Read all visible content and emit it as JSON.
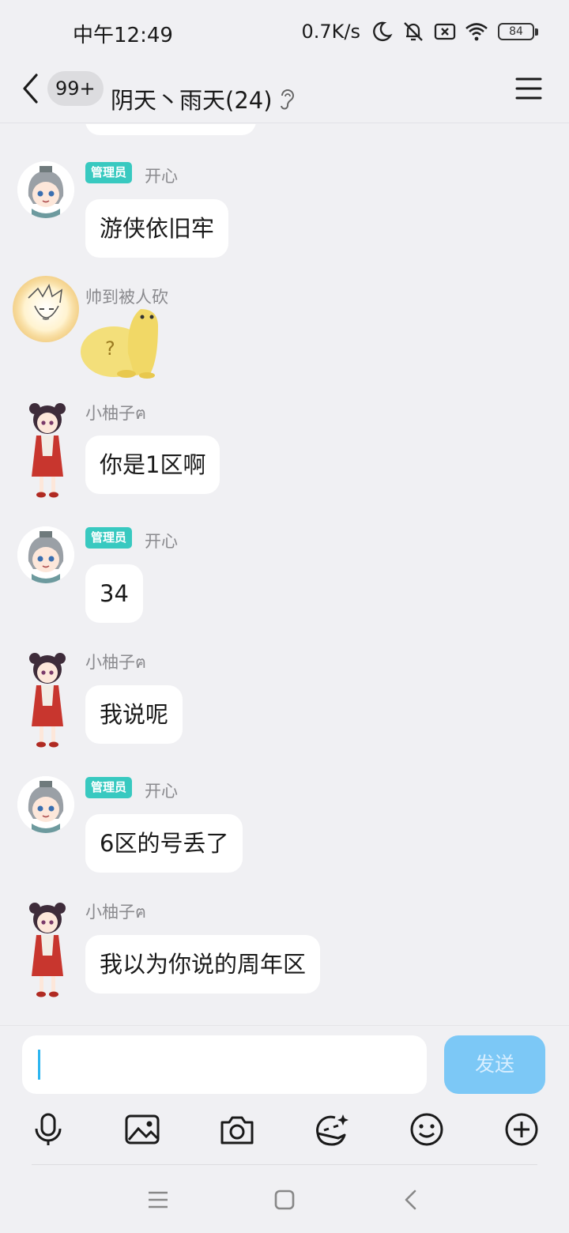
{
  "status_bar": {
    "time": "中午12:49",
    "net_speed": "0.7K/s",
    "battery": "84",
    "icons": [
      "moon-icon",
      "bell-off-icon",
      "sim-x-icon",
      "wifi-icon",
      "battery-icon"
    ]
  },
  "header": {
    "back_icon": "chevron-left-icon",
    "unread_count": "99+",
    "title": "阴天丶雨天(24)",
    "ear_icon": "ear-icon",
    "menu_icon": "hamburger-menu-icon"
  },
  "messages": [
    {
      "sender": "",
      "text": ""
    },
    {
      "sender": "开心",
      "role": "管理员",
      "text": "游侠依旧牢"
    },
    {
      "sender": "帅到被人砍",
      "text": "",
      "sticker": "yellow-blob-question-sticker"
    },
    {
      "sender": "小柚子ฅ",
      "text": "你是1区啊"
    },
    {
      "sender": "开心",
      "role": "管理员",
      "text": "34"
    },
    {
      "sender": "小柚子ฅ",
      "text": "我说呢"
    },
    {
      "sender": "开心",
      "role": "管理员",
      "text": "6区的号丢了"
    },
    {
      "sender": "小柚子ฅ",
      "text": "我以为你说的周年区"
    }
  ],
  "composer": {
    "input_value": "",
    "send_label": "发送",
    "tools": [
      "microphone-icon",
      "image-icon",
      "camera-icon",
      "sticker-face-icon",
      "emoji-icon",
      "plus-circle-icon"
    ]
  },
  "nav_bar": {
    "icons": [
      "menu-nav-icon",
      "home-square-icon",
      "back-nav-icon"
    ]
  },
  "colors": {
    "admin_tag": "#38c9c0",
    "send_button": "#7cc8f6",
    "background": "#f0f0f3",
    "bubble": "#ffffff"
  }
}
